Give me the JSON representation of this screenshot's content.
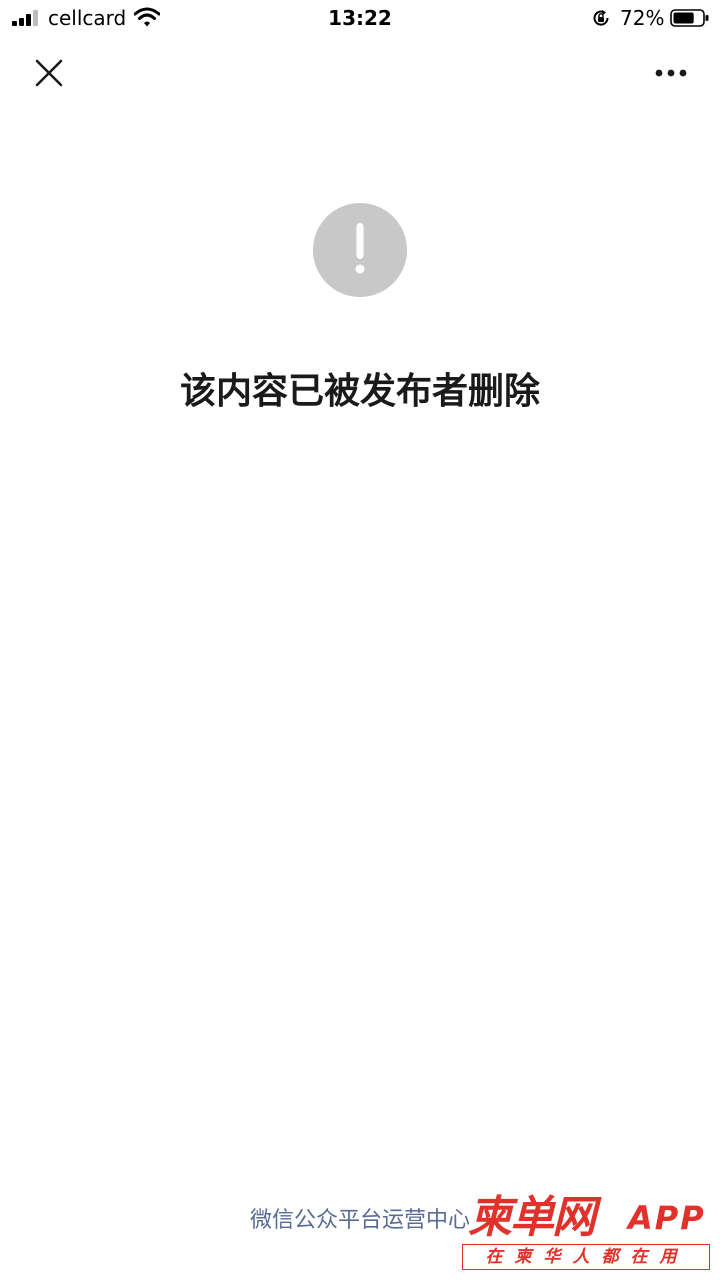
{
  "status_bar": {
    "carrier": "cellcard",
    "time": "13:22",
    "battery_percent": "72%",
    "battery_level": 0.72,
    "signal_icon": "signal-bars-icon",
    "wifi_icon": "wifi-icon",
    "rotation_lock_icon": "rotation-lock-icon",
    "battery_icon": "battery-icon"
  },
  "nav": {
    "close_icon": "close-icon",
    "more_icon": "more-dots-icon"
  },
  "content": {
    "alert_icon": "exclamation-circle-icon",
    "message": "该内容已被发布者删除"
  },
  "footer": {
    "text": "微信公众平台运营中心"
  },
  "watermark": {
    "brand": "柬单网",
    "suffix": "APP",
    "slogan": "在柬华人都在用"
  },
  "colors": {
    "background": "#ffffff",
    "alert_circle": "#c8c8c8",
    "message_text": "#1a1a1a",
    "footer_link": "#576b95",
    "watermark_red": "#e0312a"
  }
}
